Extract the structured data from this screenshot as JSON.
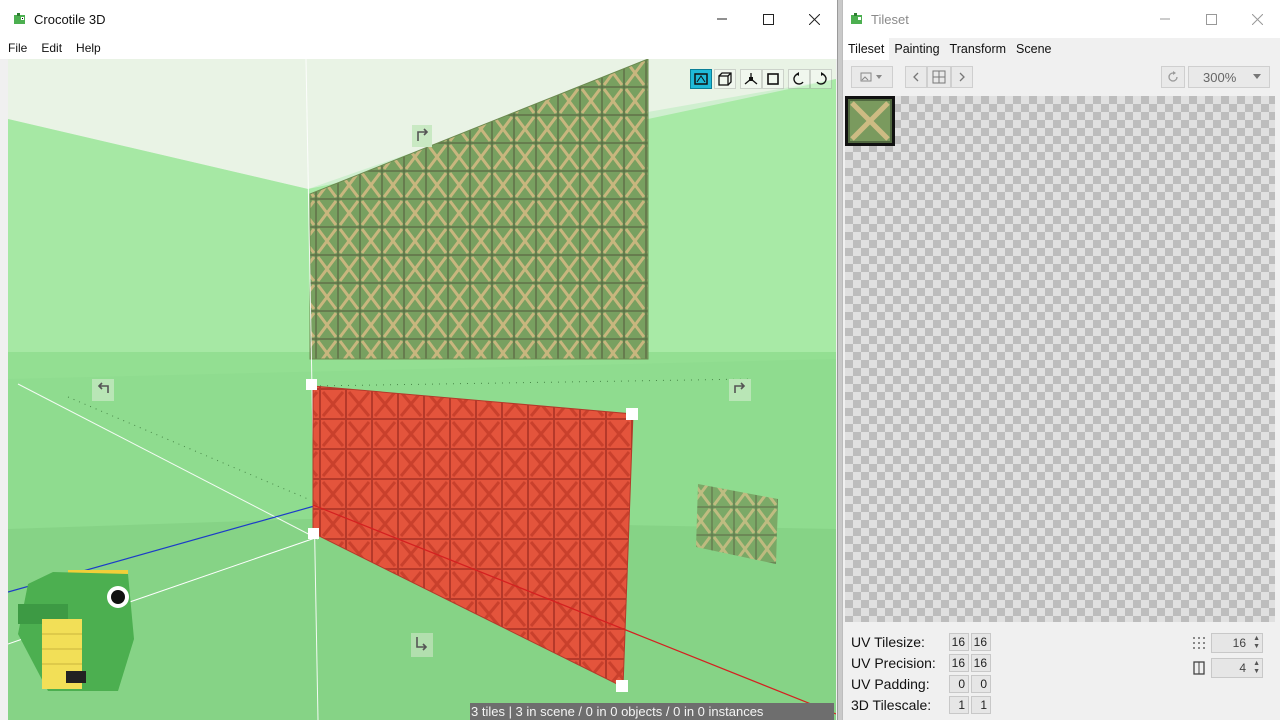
{
  "main_window": {
    "title": "Crocotile 3D",
    "menu": [
      "File",
      "Edit",
      "Help"
    ],
    "status": "3 tiles | 3 in scene / 0 in 0 objects / 0 in 0 instances"
  },
  "viewport_toolbar": {
    "tools": [
      "paint-mode-icon",
      "cube-mode-icon",
      "vertex-mode-icon",
      "face-mode-icon",
      "rotate-left-icon",
      "rotate-right-icon"
    ],
    "active": "paint-mode-icon"
  },
  "colors": {
    "accent": "#1fb9d8",
    "selection": "#e4543c",
    "sky": "#cfefcf",
    "floor": "#8fdc8f"
  },
  "tileset_window": {
    "title": "Tileset",
    "tabs": [
      "Tileset",
      "Painting",
      "Transform",
      "Scene"
    ],
    "active_tab": "Tileset",
    "zoom": "300%",
    "props": {
      "uv_tilesize": {
        "label": "UV Tilesize:",
        "x": "16",
        "y": "16"
      },
      "uv_precision": {
        "label": "UV Precision:",
        "x": "16",
        "y": "16"
      },
      "uv_padding": {
        "label": "UV Padding:",
        "x": "0",
        "y": "0"
      },
      "tilescale_3d": {
        "label": "3D Tilescale:",
        "x": "1",
        "y": "1"
      }
    },
    "grid_size": "16",
    "brush_size": "4"
  }
}
